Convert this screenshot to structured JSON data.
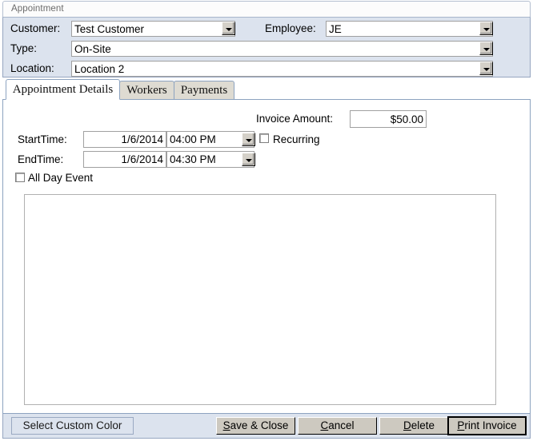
{
  "window": {
    "document_tab_label": "Appointment"
  },
  "header": {
    "customer_label": "Customer:",
    "customer_value": "Test Customer",
    "employee_label": "Employee:",
    "employee_value": "JE",
    "type_label": "Type:",
    "type_value": "On-Site",
    "location_label": "Location:",
    "location_value": "Location 2"
  },
  "tabs": [
    {
      "label": "Appointment Details",
      "active": true
    },
    {
      "label": "Workers",
      "active": false
    },
    {
      "label": "Payments",
      "active": false
    }
  ],
  "details": {
    "invoice_amount_label": "Invoice Amount:",
    "invoice_amount_value": "$50.00",
    "start_time_label": "StartTime:",
    "start_date_value": "1/6/2014",
    "start_time_value": "04:00 PM",
    "end_time_label": "EndTime:",
    "end_date_value": "1/6/2014",
    "end_time_value": "04:30 PM",
    "recurring_label": "Recurring",
    "recurring_checked": false,
    "all_day_label": "All Day Event",
    "all_day_checked": false,
    "notes_value": ""
  },
  "footer": {
    "select_color_label": "Select Custom Color",
    "save_close_prefix": "S",
    "save_close_rest": "ave & Close",
    "cancel_prefix": "C",
    "cancel_rest": "ancel",
    "delete_prefix": "D",
    "delete_rest": "elete",
    "print_prefix": "P",
    "print_rest": "rint Invoice"
  },
  "colors": {
    "panel": "#dce3ee",
    "panel_border": "#96a6c0",
    "tab_inactive": "#dedbd2",
    "button_face": "#cdc9c0",
    "dropdown_face": "#d4d0c8"
  }
}
